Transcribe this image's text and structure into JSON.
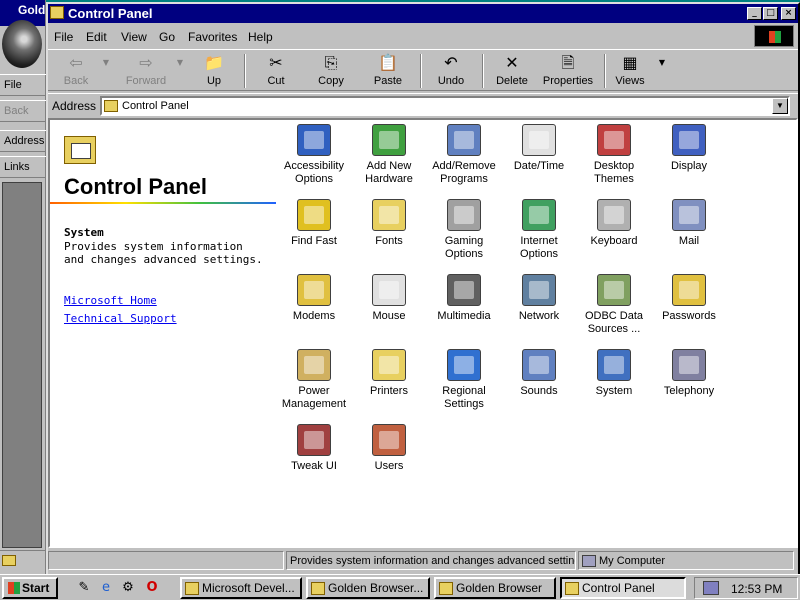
{
  "background_window": {
    "title": "Gold",
    "menu_file": "File",
    "back": "Back",
    "address": "Address",
    "links": "Links"
  },
  "window": {
    "title": "Control Panel",
    "controls": {
      "minimize": "_",
      "maximize": "□",
      "close": "×"
    }
  },
  "menubar": [
    "File",
    "Edit",
    "View",
    "Go",
    "Favorites",
    "Help"
  ],
  "toolbar": {
    "back": "Back",
    "forward": "Forward",
    "up": "Up",
    "cut": "Cut",
    "copy": "Copy",
    "paste": "Paste",
    "undo": "Undo",
    "delete": "Delete",
    "properties": "Properties",
    "views": "Views"
  },
  "address": {
    "label": "Address",
    "value": "Control Panel"
  },
  "left_pane": {
    "title": "Control Panel",
    "selected_name": "System",
    "selected_desc": "Provides system information and changes advanced settings.",
    "links": [
      "Microsoft Home",
      "Technical Support"
    ]
  },
  "icons": [
    {
      "label": "Accessibility Options",
      "color": "#3060c0"
    },
    {
      "label": "Add New Hardware",
      "color": "#40a040"
    },
    {
      "label": "Add/Remove Programs",
      "color": "#6080c0"
    },
    {
      "label": "Date/Time",
      "color": "#e0e0e0"
    },
    {
      "label": "Desktop Themes",
      "color": "#c04040"
    },
    {
      "label": "Display",
      "color": "#4060c0"
    },
    {
      "label": "Find Fast",
      "color": "#e0c020"
    },
    {
      "label": "Fonts",
      "color": "#e8d060"
    },
    {
      "label": "Gaming Options",
      "color": "#a0a0a0"
    },
    {
      "label": "Internet Options",
      "color": "#40a060"
    },
    {
      "label": "Keyboard",
      "color": "#b0b0b0"
    },
    {
      "label": "Mail",
      "color": "#8090c0"
    },
    {
      "label": "Modems",
      "color": "#e0c040"
    },
    {
      "label": "Mouse",
      "color": "#e0e0e0"
    },
    {
      "label": "Multimedia",
      "color": "#606060"
    },
    {
      "label": "Network",
      "color": "#6080a0"
    },
    {
      "label": "ODBC Data Sources ...",
      "color": "#80a060"
    },
    {
      "label": "Passwords",
      "color": "#e0c040"
    },
    {
      "label": "Power Management",
      "color": "#d0b060"
    },
    {
      "label": "Printers",
      "color": "#e8d060"
    },
    {
      "label": "Regional Settings",
      "color": "#3070d0"
    },
    {
      "label": "Sounds",
      "color": "#6080c0"
    },
    {
      "label": "System",
      "color": "#4070c0"
    },
    {
      "label": "Telephony",
      "color": "#8080a0"
    },
    {
      "label": "Tweak UI",
      "color": "#a04040"
    },
    {
      "label": "Users",
      "color": "#c06040"
    }
  ],
  "status": {
    "text": "Provides system information and changes advanced settings.",
    "zone": "My Computer"
  },
  "taskbar": {
    "start": "Start",
    "tasks": [
      "Microsoft Devel...",
      "Golden Browser...",
      "Golden Browser",
      "Control Panel"
    ],
    "clock": "12:53 PM"
  }
}
